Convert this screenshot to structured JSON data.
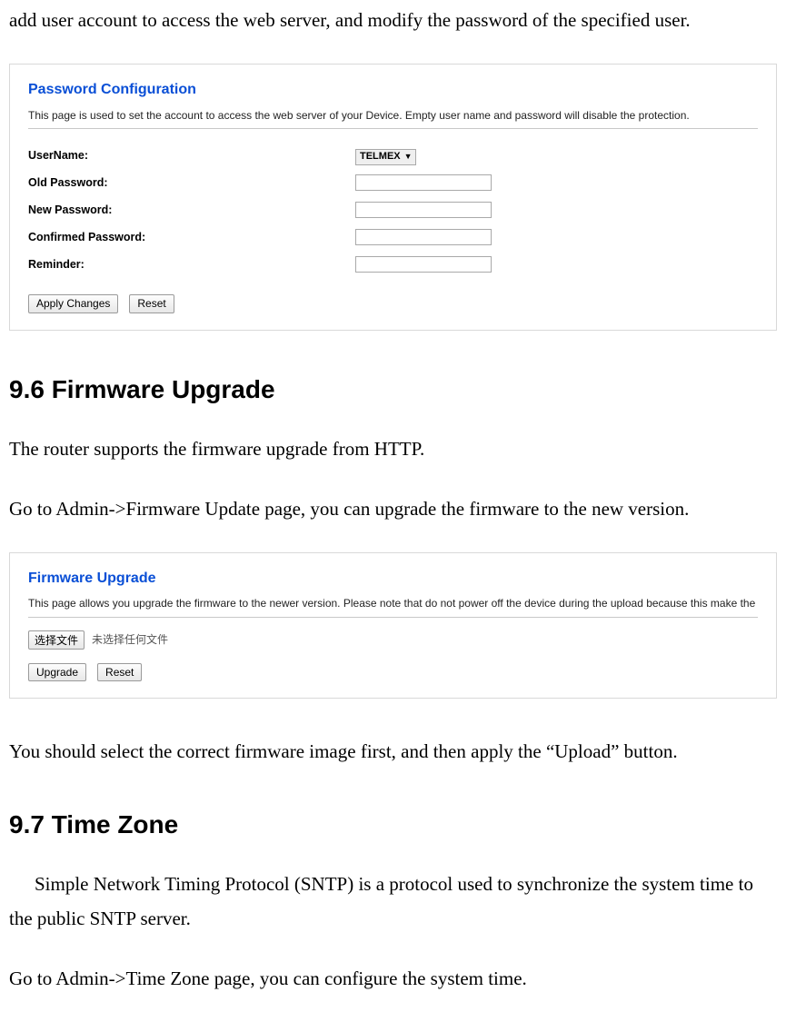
{
  "intro_top": "add user account to access the web server, and modify the password of the specified user.",
  "password_panel": {
    "title": "Password Configuration",
    "description": "This page is used to set the account to access the web server of your Device. Empty user name and password will disable the protection.",
    "labels": {
      "username": "UserName:",
      "old_password": "Old Password:",
      "new_password": "New Password:",
      "confirmed_password": "Confirmed Password:",
      "reminder": "Reminder:"
    },
    "username_value": "TELMEX",
    "values": {
      "old_password": "",
      "new_password": "",
      "confirmed_password": "",
      "reminder": ""
    },
    "buttons": {
      "apply": "Apply Changes",
      "reset": "Reset"
    }
  },
  "section_firmware": {
    "heading": "9.6 Firmware Upgrade",
    "p1": "The router supports the firmware upgrade from HTTP.",
    "p2": "Go to Admin->Firmware Update page, you can upgrade the firmware to the new version."
  },
  "firmware_panel": {
    "title": "Firmware Upgrade",
    "description": "This page allows you upgrade the firmware to the newer version. Please note that do not power off the device during the upload because this make the system unbootable.",
    "file_button": "选择文件",
    "file_status": "未选择任何文件",
    "buttons": {
      "upgrade": "Upgrade",
      "reset": "Reset"
    }
  },
  "after_firmware": "You should select the correct firmware image first, and then apply the “Upload” button.",
  "section_timezone": {
    "heading": "9.7 Time Zone",
    "p1": "Simple Network Timing Protocol (SNTP) is a protocol used to synchronize the system time to the public SNTP server.",
    "p2": "Go to Admin->Time Zone page, you can configure the system time."
  }
}
